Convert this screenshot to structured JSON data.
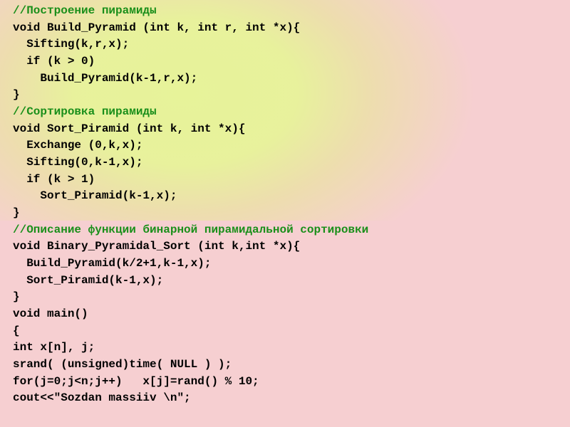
{
  "code": {
    "l01": "//Построение пирамиды",
    "l02": "void Build_Pyramid (int k, int r, int *x){",
    "l03": "  Sifting(k,r,x);",
    "l04": "  if (k > 0)",
    "l05": "    Build_Pyramid(k-1,r,x);",
    "l06": "}",
    "l07": "//Сортировка пирамиды",
    "l08": "void Sort_Piramid (int k, int *x){",
    "l09": "  Exchange (0,k,x);",
    "l10": "  Sifting(0,k-1,x);",
    "l11": "  if (k > 1)",
    "l12": "    Sort_Piramid(k-1,x);",
    "l13": "}",
    "l14": "//Описание функции бинарной пирамидальной сортировки",
    "l15": "void Binary_Pyramidal_Sort (int k,int *x){",
    "l16": "  Build_Pyramid(k/2+1,k-1,x);",
    "l17": "  Sort_Piramid(k-1,x);",
    "l18": "}",
    "l19": "void main()",
    "l20": "{",
    "l21": "int x[n], j;",
    "l22": "srand( (unsigned)time( NULL ) );",
    "l23": "for(j=0;j<n;j++)   x[j]=rand() % 10;",
    "l24": "cout<<\"Sozdan massiiv \\n\";"
  }
}
